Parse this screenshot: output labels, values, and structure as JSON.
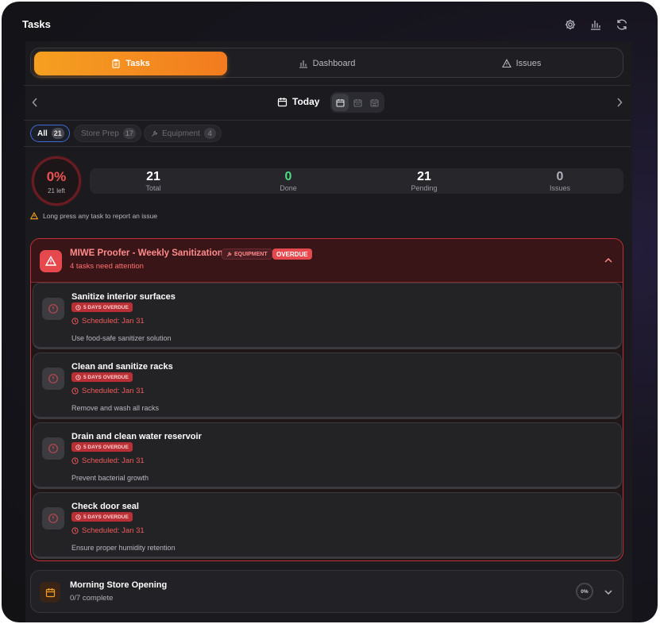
{
  "header": {
    "title": "Tasks",
    "icons": [
      "settings-icon",
      "bar-chart-icon",
      "refresh-icon"
    ]
  },
  "tabs": [
    {
      "label": "Tasks",
      "icon": "clipboard-icon",
      "active": true
    },
    {
      "label": "Dashboard",
      "icon": "bar-chart-icon",
      "active": false
    },
    {
      "label": "Issues",
      "icon": "warning-icon",
      "active": false
    }
  ],
  "date_nav": {
    "label": "Today",
    "views": [
      "day",
      "week",
      "month"
    ],
    "active_view": "day"
  },
  "filters": [
    {
      "label": "All",
      "count": "21",
      "active": true
    },
    {
      "label": "Store Prep",
      "count": "17",
      "active": false
    },
    {
      "label": "Equipment",
      "count": "4",
      "active": false
    }
  ],
  "progress": {
    "percent": "0%",
    "left": "21 left"
  },
  "stats": [
    {
      "value": "21",
      "label": "Total",
      "color": "#ffffff"
    },
    {
      "value": "0",
      "label": "Done",
      "color": "#4ade80"
    },
    {
      "value": "21",
      "label": "Pending",
      "color": "#ffffff"
    },
    {
      "value": "0",
      "label": "Issues",
      "color": "#b0b0b8"
    }
  ],
  "hint": "Long press any task to report an issue",
  "overdue_group": {
    "title": "MIWE Proofer - Weekly Sanitization",
    "tag": "EQUIPMENT",
    "status": "OVERDUE",
    "subtitle": "4 tasks need attention",
    "tasks": [
      {
        "title": "Sanitize interior surfaces",
        "badge": "5 DAYS OVERDUE",
        "scheduled": "Scheduled: Jan 31",
        "description": "Use food-safe sanitizer solution"
      },
      {
        "title": "Clean and sanitize racks",
        "badge": "5 DAYS OVERDUE",
        "scheduled": "Scheduled: Jan 31",
        "description": "Remove and wash all racks"
      },
      {
        "title": "Drain and clean water reservoir",
        "badge": "5 DAYS OVERDUE",
        "scheduled": "Scheduled: Jan 31",
        "description": "Prevent bacterial growth"
      },
      {
        "title": "Check door seal",
        "badge": "5 DAYS OVERDUE",
        "scheduled": "Scheduled: Jan 31",
        "description": "Ensure proper humidity retention"
      }
    ]
  },
  "group2": {
    "title": "Morning Store Opening",
    "subtitle": "0/7 complete",
    "percent": "0%"
  },
  "colors": {
    "accent": "#f5a020",
    "danger": "#e5484d",
    "success": "#4ade80"
  }
}
